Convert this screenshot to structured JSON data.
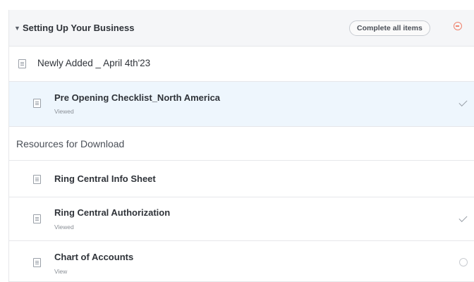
{
  "section": {
    "title": "Setting Up Your Business",
    "complete_all_label": "Complete all items"
  },
  "items": [
    {
      "title": "Newly Added _ April 4th'23",
      "status": ""
    },
    {
      "title": "Pre Opening Checklist_North America",
      "status": "Viewed"
    }
  ],
  "resources": {
    "title": "Resources for Download",
    "items": [
      {
        "title": "Ring Central Info Sheet",
        "status": ""
      },
      {
        "title": "Ring Central Authorization",
        "status": "Viewed"
      },
      {
        "title": "Chart of Accounts",
        "status": "View"
      }
    ]
  },
  "colors": {
    "header_bg": "#f5f6f8",
    "selected_bg": "#eef6fd",
    "accent_red": "#f0836e",
    "border": "#e6e7ea"
  },
  "icons": {
    "caret": "caret-down-icon",
    "collapse": "collapse-circle-icon",
    "doc": "document-icon",
    "check": "check-icon",
    "status": "empty-circle-icon"
  }
}
